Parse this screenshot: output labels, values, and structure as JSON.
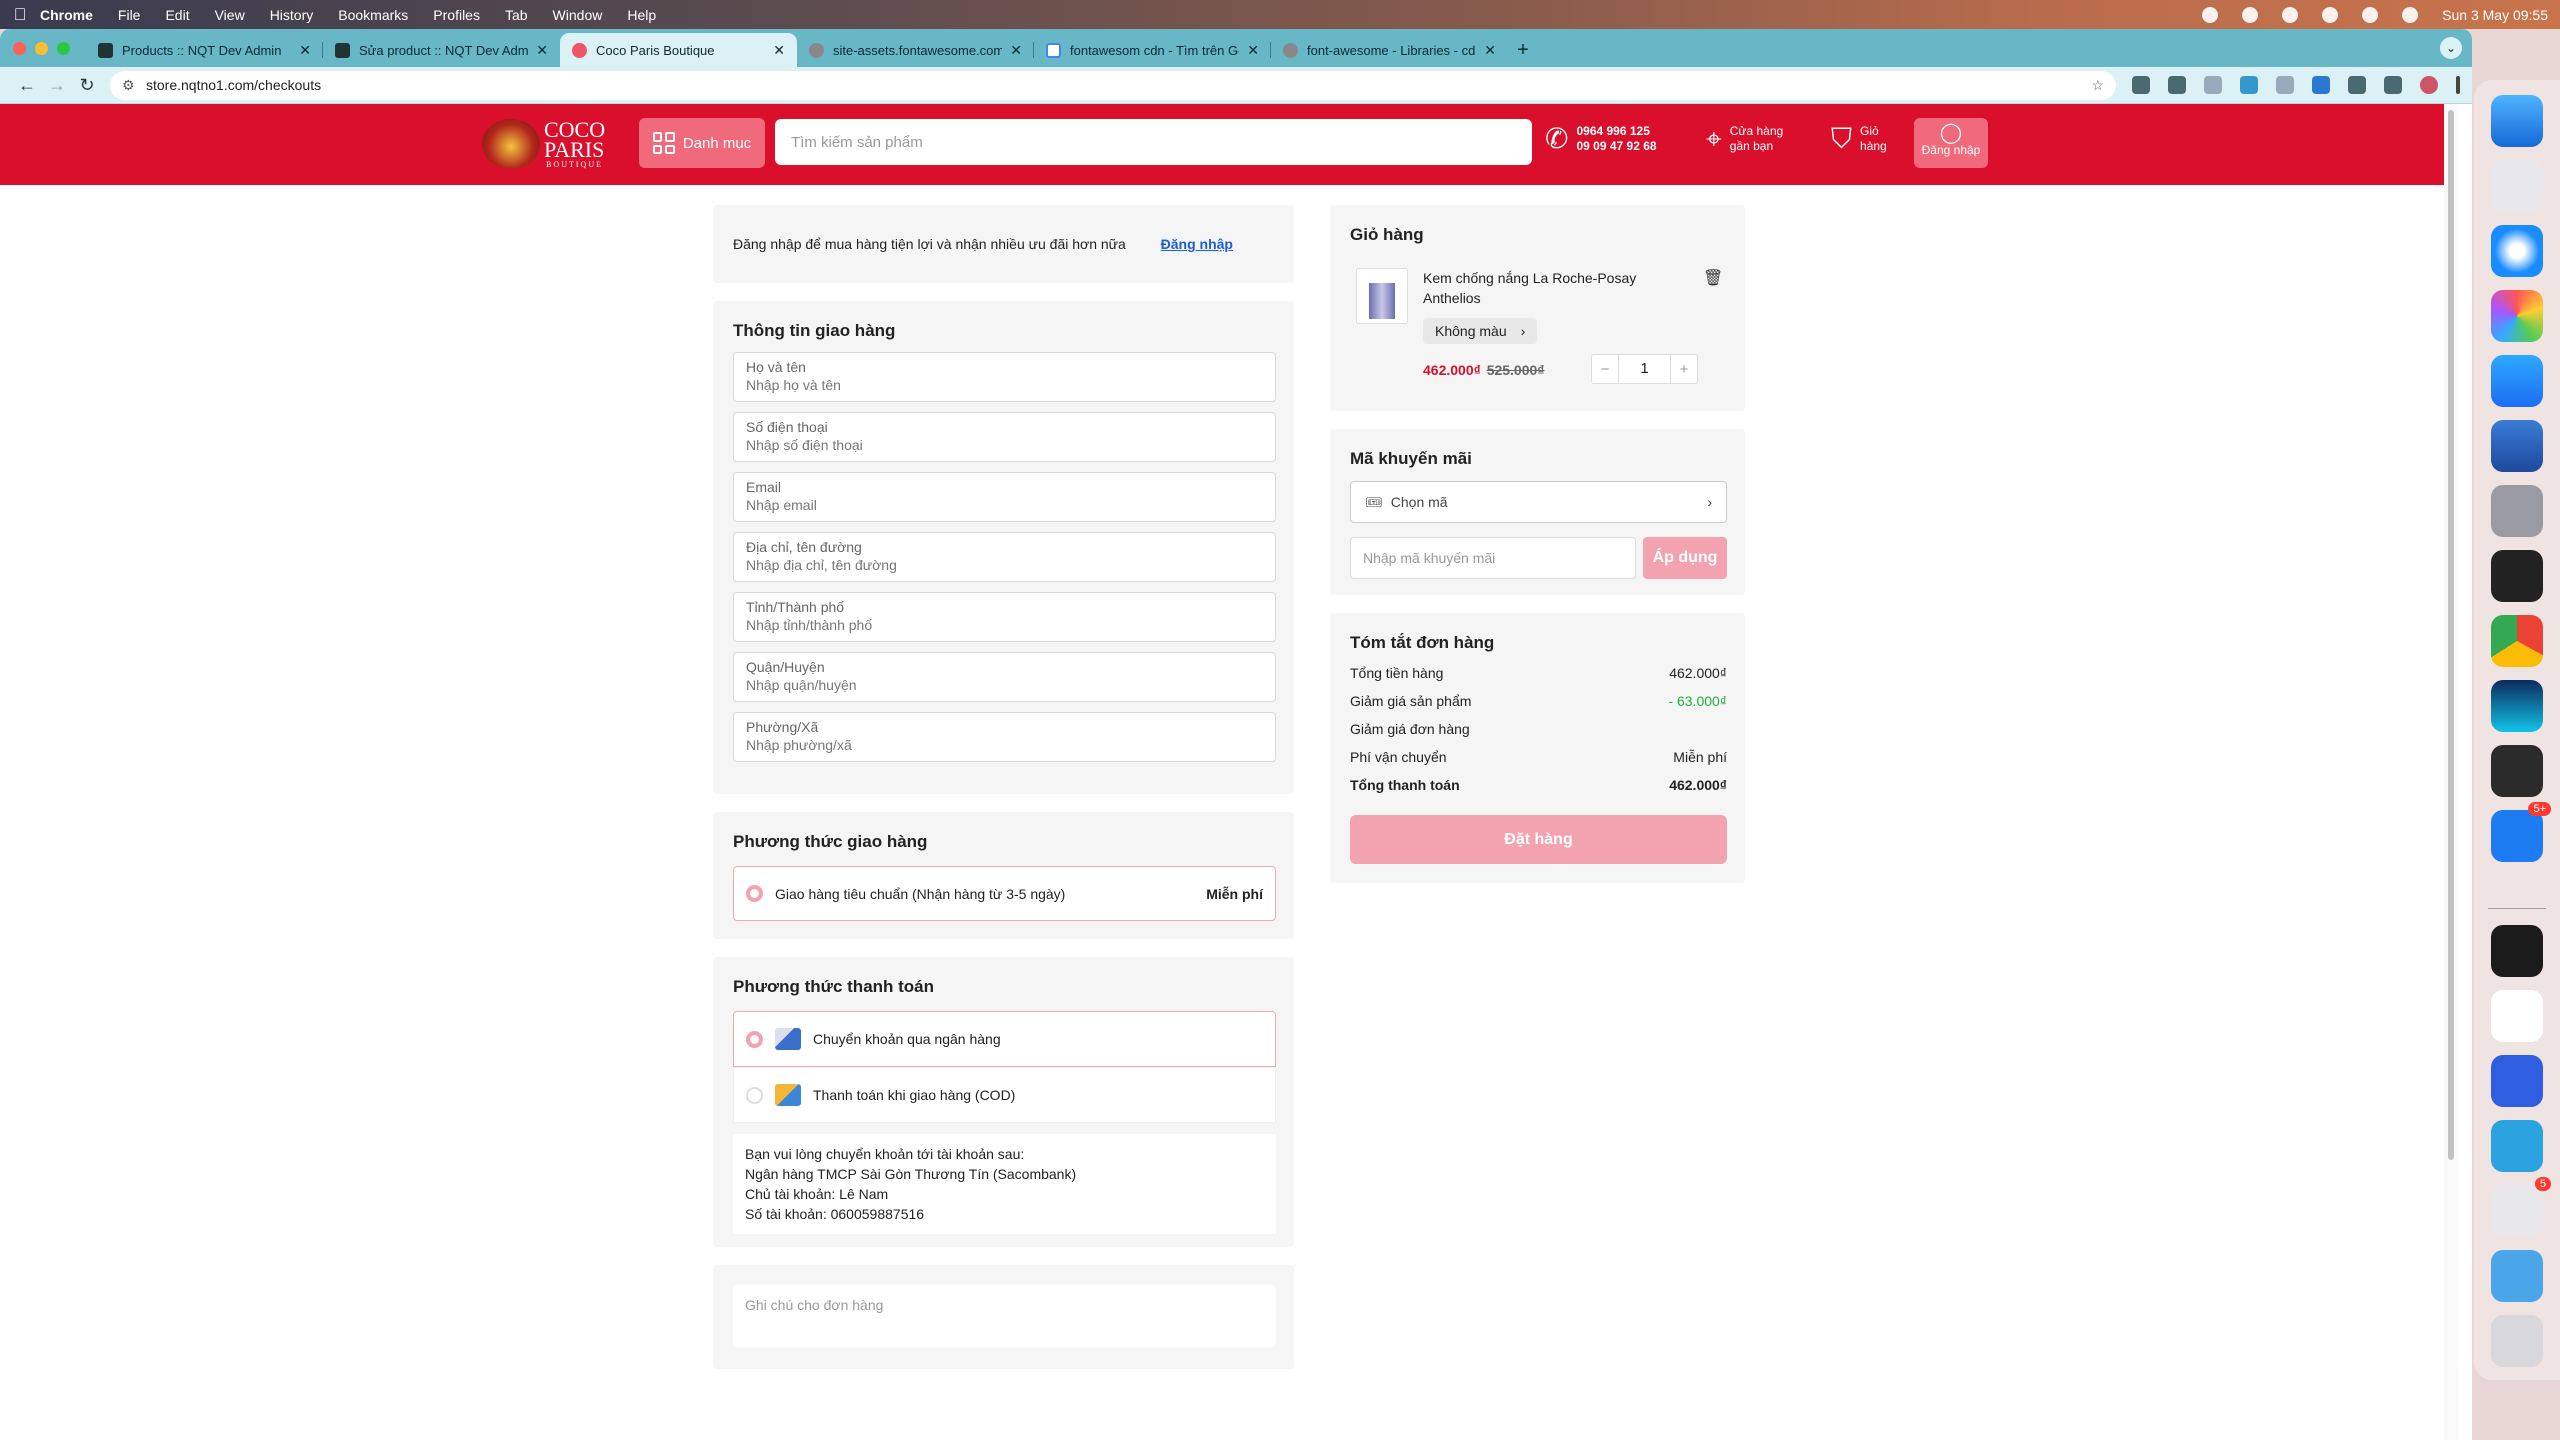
{
  "menubar": {
    "app": "Chrome",
    "items": [
      "File",
      "Edit",
      "View",
      "History",
      "Bookmarks",
      "Profiles",
      "Tab",
      "Window",
      "Help"
    ],
    "clock": "Sun 3 May  09:55"
  },
  "browser": {
    "tabs": [
      {
        "title": "Products :: NQT Dev Admin",
        "active": false
      },
      {
        "title": "Sửa product :: NQT Dev Admin",
        "active": false
      },
      {
        "title": "Coco Paris Boutique",
        "active": true
      },
      {
        "title": "site-assets.fontawesome.com",
        "active": false
      },
      {
        "title": "fontawesom cdn - Tìm trên Google",
        "active": false
      },
      {
        "title": "font-awesome - Libraries - cdnjs",
        "active": false
      }
    ],
    "url": "store.nqtno1.com/checkouts"
  },
  "header": {
    "logo_line1": "COCO",
    "logo_line2": "PARIS",
    "logo_line3": "BOUTIQUE",
    "category_label": "Danh mục",
    "search_placeholder": "Tìm kiếm sản phẩm",
    "phone1": "0964 996 125",
    "phone2": "09 09 47 92 68",
    "store_line1": "Cửa hàng",
    "store_line2": "gần bạn",
    "cart_line1": "Giỏ",
    "cart_line2": "hàng",
    "login_label": "Đăng nhập"
  },
  "login_prompt": {
    "text": "Đăng nhập để mua hàng tiện lợi và nhận nhiều ưu đãi hơn nữa",
    "link": "Đăng nhập"
  },
  "shipping_info": {
    "title": "Thông tin giao hàng",
    "fields": [
      {
        "label": "Họ và tên",
        "placeholder": "Nhập họ và tên"
      },
      {
        "label": "Số điện thoại",
        "placeholder": "Nhập số điện thoại"
      },
      {
        "label": "Email",
        "placeholder": "Nhập email"
      },
      {
        "label": "Địa chỉ, tên đường",
        "placeholder": "Nhập địa chỉ, tên đường"
      },
      {
        "label": "Tỉnh/Thành phố",
        "placeholder": "Nhập tỉnh/thành phố"
      },
      {
        "label": "Quận/Huyện",
        "placeholder": "Nhập quận/huyện"
      },
      {
        "label": "Phường/Xã",
        "placeholder": "Nhập phường/xã"
      }
    ]
  },
  "delivery": {
    "title": "Phương thức giao hàng",
    "option": "Giao hàng tiêu chuẩn (Nhận hàng từ 3-5 ngày)",
    "price": "Miễn phí"
  },
  "payment": {
    "title": "Phương thức thanh toán",
    "options": [
      "Chuyển khoản qua ngân hàng",
      "Thanh toán khi giao hàng (COD)"
    ],
    "bank_lines": [
      "Bạn vui lòng chuyển khoản tới tài khoản sau:",
      "Ngân hàng TMCP Sài Gòn Thương Tín (Sacombank)",
      "Chủ tài khoản: Lê Nam",
      "Số tài khoản: 060059887516"
    ]
  },
  "notes": {
    "placeholder": "Ghi chú cho đơn hàng"
  },
  "cart": {
    "title": "Giỏ hàng",
    "product_name": "Kem chống nắng La Roche-Posay Anthelios",
    "variant": "Không màu",
    "price": "462.000₫",
    "old_price": "525.000₫",
    "quantity": "1"
  },
  "promo": {
    "title": "Mã khuyến mãi",
    "choose_label": "Chọn mã",
    "input_placeholder": "Nhập mã khuyến mãi",
    "apply_label": "Áp dụng"
  },
  "summary": {
    "title": "Tóm tắt đơn hàng",
    "rows": [
      {
        "label": "Tổng tiền hàng",
        "value": "462.000₫"
      },
      {
        "label": "Giảm giá sản phẩm",
        "value": "- 63.000₫"
      },
      {
        "label": "Giảm giá đơn hàng",
        "value": ""
      },
      {
        "label": "Phí vận chuyển",
        "value": "Miễn phí"
      },
      {
        "label": "Tổng thanh toán",
        "value": "462.000₫"
      }
    ],
    "order_button": "Đặt hàng"
  },
  "dock": {
    "badges": {
      "zalo": "5+",
      "slack": "5"
    }
  },
  "colors": {
    "brand_red": "#da0f2b",
    "accent_pink": "#f3a3b0",
    "tab_teal": "#67b7c6"
  }
}
